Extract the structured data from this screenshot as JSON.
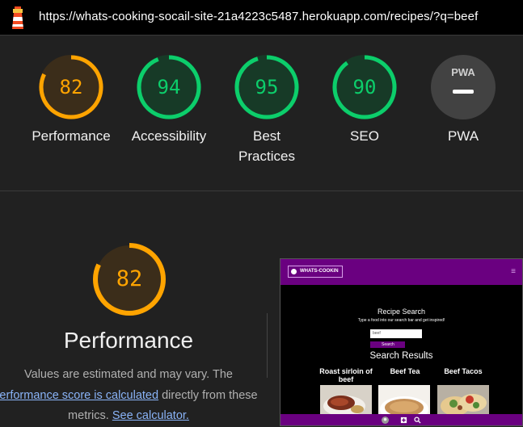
{
  "address_bar": {
    "url": "https://whats-cooking-socail-site-21a4223c5487.herokuapp.com/recipes/?q=beef"
  },
  "gauges": [
    {
      "label": "Performance",
      "score": "82",
      "fraction": 0.82,
      "color": "#ffa400",
      "bg": "#3b2d1a"
    },
    {
      "label": "Accessibility",
      "score": "94",
      "fraction": 0.94,
      "color": "#0cce6b",
      "bg": "#173a27"
    },
    {
      "label": "Best Practices",
      "score": "95",
      "fraction": 0.95,
      "color": "#0cce6b",
      "bg": "#173a27"
    },
    {
      "label": "SEO",
      "score": "90",
      "fraction": 0.9,
      "color": "#0cce6b",
      "bg": "#173a27"
    },
    {
      "label": "PWA",
      "score": "PWA",
      "color": "#ffffff",
      "bg": "#424242"
    }
  ],
  "performance": {
    "score": "82",
    "fraction": 0.82,
    "title": "Performance",
    "desc_prefix": "Values are estimated and may vary. The",
    "link_score": "erformance score is calculated",
    "desc_middle": "directly from these metrics.",
    "link_calc": "See calculator."
  },
  "thumbnail": {
    "logo": "WHATS-COOKIN",
    "menu": "≡",
    "heading": "Recipe Search",
    "subheading": "Type a food into our search bar and get inspired!",
    "search_value": "beef",
    "search_button": "Search",
    "results_title": "Search Results",
    "cards": [
      {
        "title": "Roast sirloin of beef"
      },
      {
        "title": "Beef Tea"
      },
      {
        "title": "Beef Tacos"
      }
    ]
  }
}
